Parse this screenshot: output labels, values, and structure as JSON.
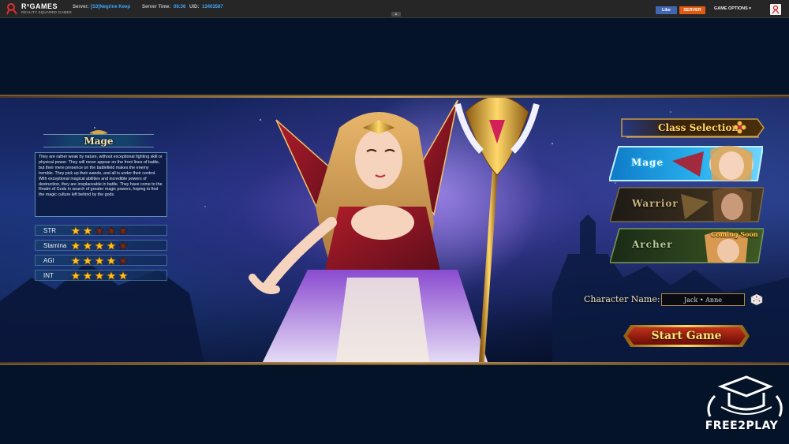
{
  "topbar": {
    "brand": "R²GAMES",
    "brand_sub": "REALITY SQUARED GAMES",
    "server_label": "Server:",
    "server_value": "[S3]Negrine Keep",
    "time_label": "Server Time:",
    "time_value": "06:36",
    "uid_label": "UID:",
    "uid_value": "13403587",
    "fb_like": "Like",
    "server_button": "SERVER",
    "game_options": "GAME OPTIONS ▾",
    "collapse": "▲"
  },
  "class_info": {
    "name": "Mage",
    "description": "They are rather weak by nature, without exceptional fighting skill or physical power. They will never appear on the front lines of battle, but their mere presence on the battlefield makes the enemy tremble. They pick up their wands, and all is under their control. With exceptional magical abilities and incredible powers of destruction, they are irreplaceable in battle. They have come to the Realm of Gods in search of greater magic powers, hoping to find the magic culture left behind by the gods.",
    "stats": [
      {
        "label": "STR",
        "stars": 2
      },
      {
        "label": "Stamina",
        "stars": 4
      },
      {
        "label": "AGI",
        "stars": 4
      },
      {
        "label": "INT",
        "stars": 5
      }
    ],
    "max_stars": 5
  },
  "class_selection": {
    "title": "Class Selection",
    "classes": [
      {
        "label": "Mage",
        "selected": true
      },
      {
        "label": "Warrior",
        "selected": false
      },
      {
        "label": "Archer",
        "selected": false,
        "badge": "Coming Soon"
      }
    ]
  },
  "character": {
    "name_label": "Character Name:",
    "name_value": "Jack • Anne"
  },
  "start_button": "Start Game",
  "watermark": "FREE2PLAY",
  "colors": {
    "star_on": "#ffc21a",
    "star_off": "#7a2a12",
    "accent_gold": "#ffd96a",
    "link_blue": "#3fa7ff"
  }
}
